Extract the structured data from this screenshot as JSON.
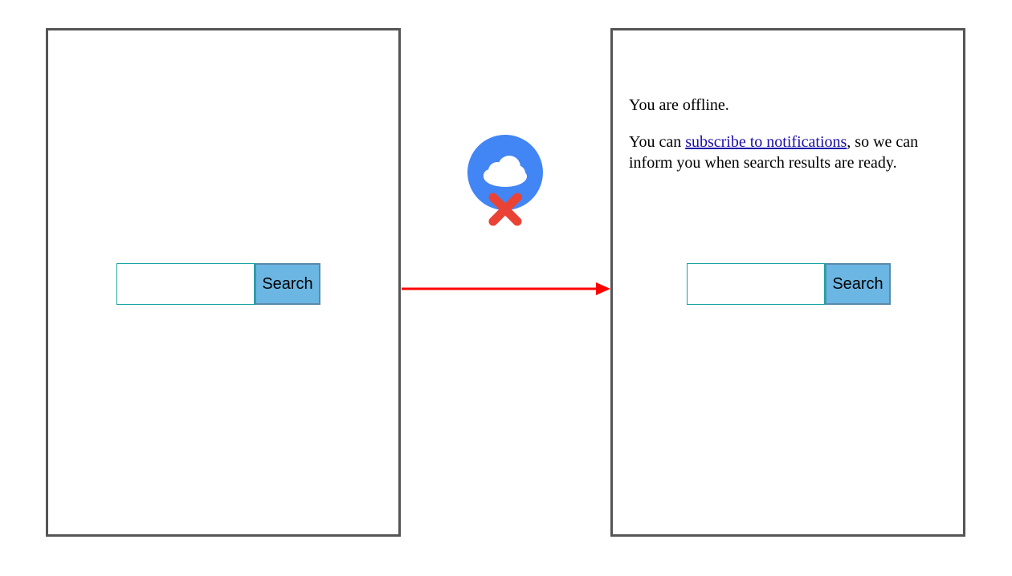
{
  "left": {
    "search": {
      "input_value": "",
      "button_label": "Search"
    }
  },
  "right": {
    "message": {
      "line1": "You are offline.",
      "line2_prefix": "You can ",
      "line2_link": "subscribe to notifications",
      "line2_suffix": ", so we can inform you when search results are ready."
    },
    "search": {
      "input_value": "",
      "button_label": "Search"
    }
  },
  "icons": {
    "cloud_offline": "cloud-offline-icon",
    "arrow": "arrow-right-icon"
  },
  "colors": {
    "panel_border": "#555555",
    "button_bg": "#6bb6e3",
    "button_border": "#5a8aa8",
    "input_border": "#19a4a4",
    "link": "#1a0dab",
    "arrow": "#ff0000",
    "cloud_badge": "#4285f4",
    "cloud_x": "#ea4335"
  }
}
